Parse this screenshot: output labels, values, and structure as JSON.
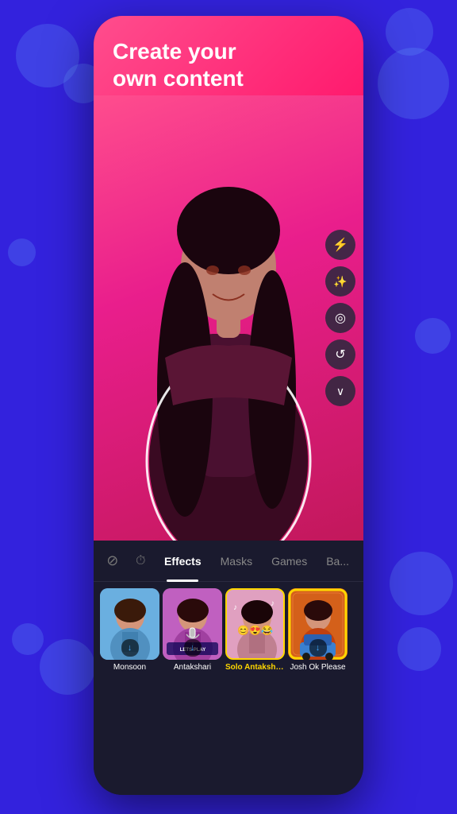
{
  "background": {
    "color": "#3322dd"
  },
  "header": {
    "title_line1": "Create your",
    "title_line2": "own content"
  },
  "toolbar": {
    "buttons": [
      {
        "icon": "⚡",
        "name": "flash-off-icon",
        "label": "Flash Off"
      },
      {
        "icon": "✨",
        "name": "beauty-icon",
        "label": "Beauty"
      },
      {
        "icon": "◎",
        "name": "filter-icon",
        "label": "Filters"
      },
      {
        "icon": "↺",
        "name": "flip-icon",
        "label": "Flip Camera"
      },
      {
        "icon": "∨",
        "name": "more-icon",
        "label": "More"
      }
    ]
  },
  "tabs": {
    "items": [
      {
        "label": "⊘",
        "name": "tab-none",
        "active": false,
        "is_icon": true
      },
      {
        "label": "⏱",
        "name": "tab-timer",
        "active": false,
        "is_icon": true
      },
      {
        "label": "Effects",
        "name": "tab-effects",
        "active": true,
        "is_icon": false
      },
      {
        "label": "Masks",
        "name": "tab-masks",
        "active": false,
        "is_icon": false
      },
      {
        "label": "Games",
        "name": "tab-games",
        "active": false,
        "is_icon": false
      },
      {
        "label": "Ba...",
        "name": "tab-background",
        "active": false,
        "is_icon": false
      }
    ]
  },
  "effects": [
    {
      "id": "monsoon",
      "label": "Monsoon",
      "selected": false,
      "has_download": true,
      "theme": "blue"
    },
    {
      "id": "antakshari",
      "label": "Antakshari",
      "selected": false,
      "has_download": true,
      "theme": "purple"
    },
    {
      "id": "solo_antakshari",
      "label": "Solo Antakshari",
      "selected": true,
      "has_download": false,
      "theme": "pink"
    },
    {
      "id": "josh_ok_please",
      "label": "Josh Ok Please",
      "selected": false,
      "has_download": true,
      "theme": "orange"
    }
  ],
  "tab_effects_label": "Effects",
  "tab_masks_label": "Masks",
  "tab_games_label": "Games",
  "tab_ba_label": "Ba"
}
